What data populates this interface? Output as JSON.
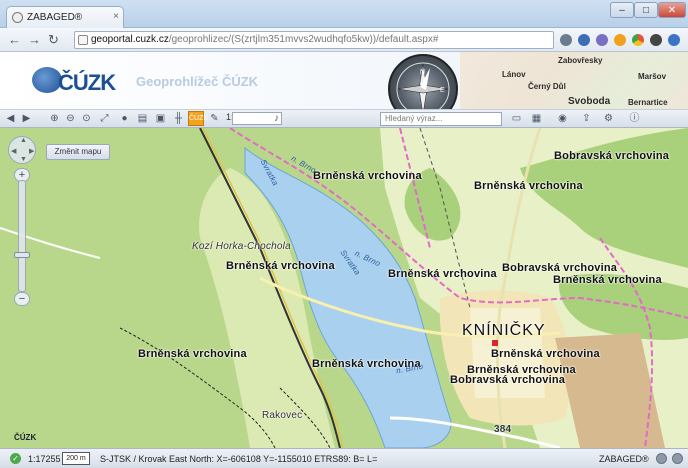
{
  "browser": {
    "tab_title": "ZABAGED®",
    "tab_close": "×",
    "url_host": "geoportal.cuzk.cz",
    "url_path": "/geoprohlizec/(S(zrtjlm351mvvs2wudhqfo5kw))/default.aspx#",
    "back_glyph": "←",
    "forward_glyph": "→",
    "reload_glyph": "↻",
    "star_glyph": "☆",
    "extension_colors": [
      "#6b7c8f",
      "#3c6db5",
      "#7a6fc2",
      "#f2a11b",
      "#e5553b",
      "#444444",
      "#3b74c7"
    ]
  },
  "header": {
    "logo_text": "ČÚZK",
    "app_title": "Geoprohlížeč ČÚZK",
    "compass_letters": [
      "N",
      "E"
    ],
    "map_places": [
      "Zabovřesky",
      "Lánov",
      "Černý Důl",
      "Svoboda",
      "Maršov",
      "Bernartice",
      "Lanov"
    ]
  },
  "toolbar": {
    "scale_prefix": "1:",
    "search_placeholder": "Hledaný výraz...",
    "active_tool_label": "ČÚZK",
    "icons": [
      "arrow-left-icon",
      "arrow-right-icon",
      "zoom-in-icon",
      "zoom-out-icon",
      "zoom-extent-icon",
      "fullscreen-icon",
      "info-icon",
      "layers-icon",
      "measure-icon",
      "ruler-icon",
      "cuzk-icon",
      "wrench-icon",
      "search-icon",
      "print-icon",
      "grid-icon",
      "globe-icon",
      "export-icon",
      "settings-icon",
      "help-icon"
    ]
  },
  "map": {
    "change_map_button": "Změnit mapu",
    "watermark": "ČÚZK",
    "labels": [
      {
        "text": "Brněnská vrchovina",
        "kind": "bold"
      },
      {
        "text": "Brněnská vrchovina",
        "kind": "bold"
      },
      {
        "text": "Bobravská vrchovina",
        "kind": "bold"
      },
      {
        "text": "Brněnská vrchovina",
        "kind": "bold"
      },
      {
        "text": "Brněnská vrchovina",
        "kind": "bold"
      },
      {
        "text": "Bobravská vrchovina",
        "kind": "bold"
      },
      {
        "text": "Brněnská vrchovina",
        "kind": "bold"
      },
      {
        "text": "Brněnská vrchovina",
        "kind": "bold"
      },
      {
        "text": "Brněnská vrchovina",
        "kind": "bold"
      },
      {
        "text": "Brněnská vrchovina",
        "kind": "bold"
      },
      {
        "text": "Brněnská vrchovina",
        "kind": "bold"
      },
      {
        "text": "Bobravská vrchovina",
        "kind": "bold"
      },
      {
        "text": "Kozí Horka-Chochola",
        "kind": "region"
      },
      {
        "text": "KNÍNIČKY",
        "kind": "town"
      },
      {
        "text": "Rakovec",
        "kind": "small"
      },
      {
        "text": "Svratka",
        "kind": "water"
      },
      {
        "text": "Svratka",
        "kind": "water"
      },
      {
        "text": "n. Brno",
        "kind": "water"
      },
      {
        "text": "n. Brno",
        "kind": "water"
      },
      {
        "text": "n. Brno",
        "kind": "water"
      },
      {
        "text": "384",
        "kind": "small"
      }
    ]
  },
  "status": {
    "ok_glyph": "✓",
    "scale": "1:17255",
    "scalebar": "200 m",
    "coords": "S-JTSK / Krovak East North:  X=-606108 Y=-1155010   ETRS89:  B= L=",
    "source": "ZABAGED®"
  }
}
